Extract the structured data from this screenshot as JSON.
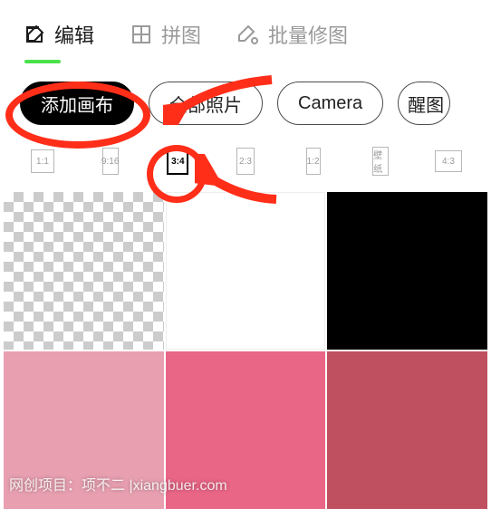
{
  "tabs": {
    "edit": {
      "label": "编辑"
    },
    "collage": {
      "label": "拼图"
    },
    "batch": {
      "label": "批量修图"
    }
  },
  "chips": {
    "add_canvas": "添加画布",
    "all_photos": "全部照片",
    "camera": "Camera",
    "xingtu": "醒图"
  },
  "ratios": {
    "r11": "1:1",
    "r916": "9:16",
    "r34": "3:4",
    "r23": "2:3",
    "r12": "1:2",
    "wall": "壁纸",
    "r43": "4:3"
  },
  "swatches": {
    "transparent": "transparent",
    "white": "white",
    "black": "black",
    "pink_light": "#e8a0b0",
    "pink_med": "#e96686",
    "pink_dark": "#be5060"
  },
  "watermark": "网创项目：项不二 |xiangbuer.com",
  "annotations": {
    "circle_add_canvas": "highlight-add-canvas",
    "circle_ratio_34": "highlight-ratio-3-4",
    "arrow_to_all_photos": "arrow",
    "arrow_to_ratio": "arrow"
  }
}
